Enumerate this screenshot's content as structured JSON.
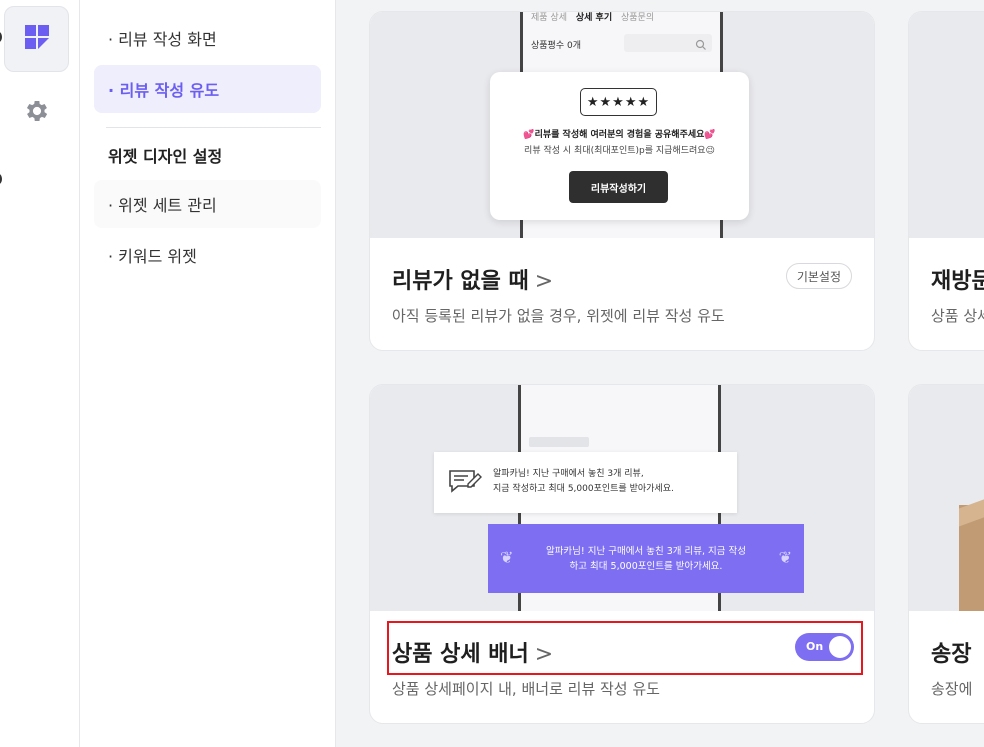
{
  "submenu": {
    "items": [
      {
        "label": "· 리뷰 작성 화면"
      },
      {
        "label": "· 리뷰 작성 유도"
      }
    ],
    "group_title": "위젯 디자인 설정",
    "group_items": [
      {
        "label": "· 위젯 세트 관리"
      },
      {
        "label": "· 키워드 위젯"
      }
    ]
  },
  "cards": {
    "no_review": {
      "title": "리뷰가 없을 때",
      "chevron": ">",
      "description": "아직 등록된 리뷰가 없을 경우, 위젯에 리뷰 작성 유도",
      "badge": "기본설정",
      "preview": {
        "tabs": [
          "제품 상세",
          "상세 후기",
          "상품문의"
        ],
        "rating_label": "상품평수 0개",
        "stars": "★★★★★",
        "line1": "💕리뷰를 작성해 여러분의 경험을 공유해주세요💕",
        "line2": "리뷰 작성 시 최대(최대포인트)p를 지급해드려요😉",
        "button": "리뷰작성하기"
      }
    },
    "revisit": {
      "title": "재방문",
      "description": "상품 상세"
    },
    "banner": {
      "title": "상품 상세 배너",
      "chevron": ">",
      "description": "상품 상세페이지 내, 배너로 리뷰 작성 유도",
      "toggle_label": "On",
      "preview": {
        "notice_line1": "알파카님! 지난 구매에서 놓친 3개 리뷰,",
        "notice_line2": "지금 작성하고 최대 5,000포인트를 받아가세요.",
        "banner_line1": "알파카님! 지난 구매에서 놓친 3개 리뷰, 지금 작성",
        "banner_line2": "하고 최대 5,000포인트를 받아가세요."
      }
    },
    "invoice": {
      "title": "송장",
      "description": "송장에"
    }
  },
  "colors": {
    "accent": "#7d6ef2",
    "highlight": "#e8171d"
  }
}
